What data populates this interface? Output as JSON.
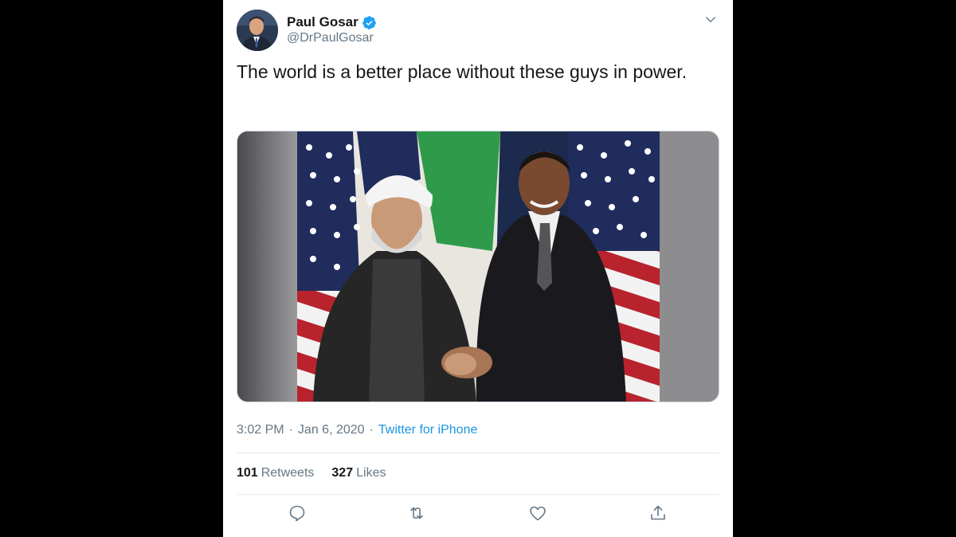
{
  "tweet": {
    "author": {
      "name": "Paul Gosar",
      "handle": "@DrPaulGosar",
      "verified": true,
      "avatar_icon": "profile-photo"
    },
    "text": "The world is a better place without these guys in power.",
    "media": {
      "type": "photo",
      "icon": "photo-handshake"
    },
    "meta": {
      "time": "3:02 PM",
      "sep1": "·",
      "date": "Jan 6, 2020",
      "sep2": "·",
      "source": "Twitter for iPhone"
    },
    "stats": {
      "retweets_count": "101",
      "retweets_label": "Retweets",
      "likes_count": "327",
      "likes_label": "Likes"
    },
    "actions": [
      "reply-icon",
      "retweet-icon",
      "like-icon",
      "share-icon"
    ]
  },
  "colors": {
    "link": "#1b95e0",
    "secondary_text": "#657786",
    "primary_text": "#14171a",
    "icon": "#657786",
    "divider": "#e6ecf0",
    "verified_badge": "#1da1f2"
  }
}
